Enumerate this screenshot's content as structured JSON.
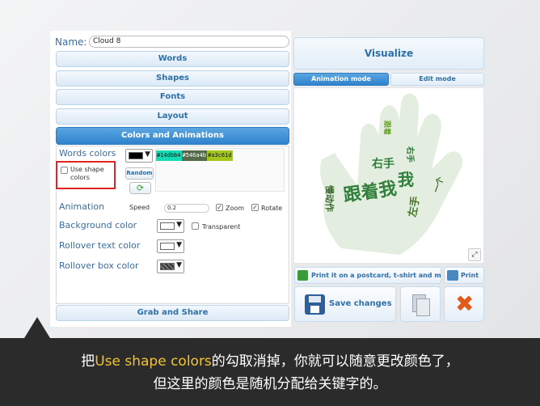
{
  "name_field": {
    "label": "Name:",
    "value": "Cloud 8"
  },
  "accordion": {
    "words": "Words",
    "shapes": "Shapes",
    "fonts": "Fonts",
    "layout": "Layout",
    "colors": "Colors and Animations",
    "grab": "Grab and Share"
  },
  "colors": {
    "words_colors_label": "Words colors",
    "use_shape_label_1": "Use shape",
    "use_shape_label_2": "colors",
    "random_label": "Random",
    "hex_values": [
      "#14dbb4",
      "#546a4b",
      "#a3c61d"
    ],
    "hex_colors": [
      "#14dbb4",
      "#546a4b",
      "#a3c61d"
    ],
    "animation_label": "Animation",
    "speed_label": "Speed",
    "speed_value": "0.2",
    "zoom_label": "Zoom",
    "rotate_label": "Rotate",
    "background_label": "Background color",
    "transparent_label": "Transparent",
    "rollover_text_label": "Rollover text color",
    "rollover_box_label": "Rollover box color"
  },
  "right": {
    "visualize": "Visualize",
    "tab_animation": "Animation mode",
    "tab_edit": "Edit mode",
    "print_postcard": "Print it on a postcard, t-shirt and more",
    "print": "Print",
    "save_changes": "Save changes"
  },
  "cloud_words": [
    {
      "t": "跟着我",
      "c": "#2f7f3a"
    },
    {
      "t": "右手",
      "c": "#2f7f3a"
    },
    {
      "t": "左手",
      "c": "#4a7a2a"
    },
    {
      "t": "我",
      "c": "#2f7f3a"
    },
    {
      "t": "右手",
      "c": "#2f7f3a"
    },
    {
      "t": "慢动作",
      "c": "#3a6a2a"
    },
    {
      "t": "跟着",
      "c": "#6aa52a"
    },
    {
      "t": "一个",
      "c": "#3a6a2a"
    }
  ],
  "caption": {
    "pre": "把",
    "highlight": "Use shape colors",
    "post": "的勾取消掉，你就可以随意更改颜色了，",
    "line2": "但这里的颜色是随机分配给关键字的。"
  }
}
